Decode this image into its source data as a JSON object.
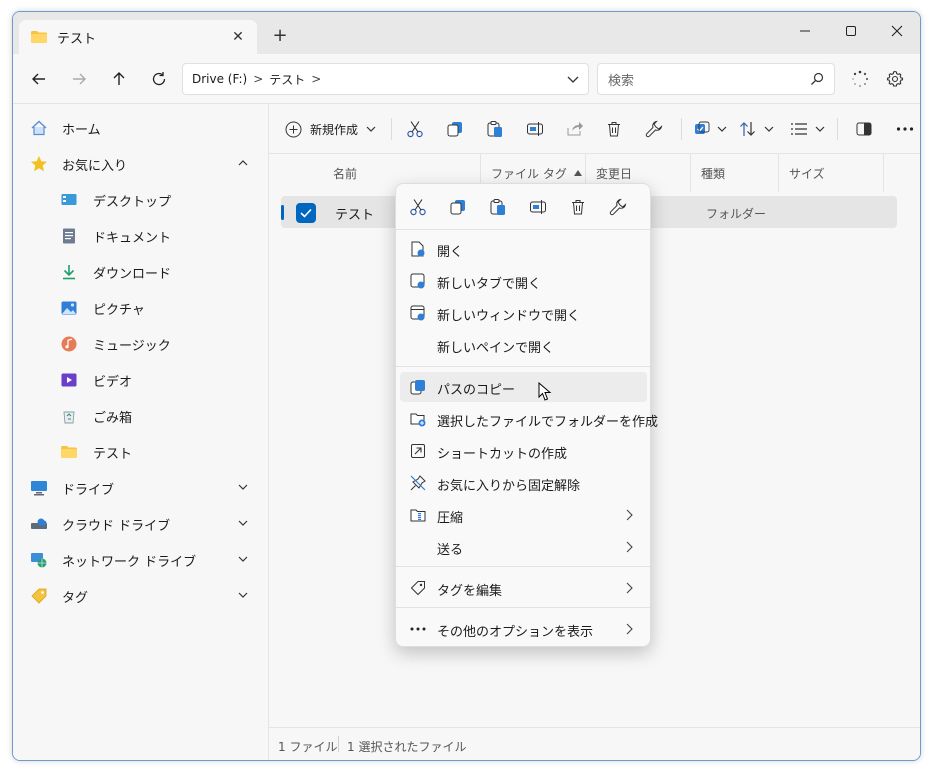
{
  "tab": {
    "title": "テスト",
    "close": "✕",
    "new_tab": "+"
  },
  "window_buttons": {
    "minimize": "—",
    "maximize": "☐",
    "close": "✕"
  },
  "address": {
    "drive": "Drive (F:)",
    "folder": "テスト",
    "separator": ">"
  },
  "search": {
    "placeholder": "検索"
  },
  "sidebar": {
    "items": [
      {
        "label": "ホーム",
        "icon": "home-icon"
      },
      {
        "label": "お気に入り",
        "icon": "star-icon"
      },
      {
        "label": "デスクトップ",
        "icon": "desktop-icon"
      },
      {
        "label": "ドキュメント",
        "icon": "document-icon"
      },
      {
        "label": "ダウンロード",
        "icon": "download-icon"
      },
      {
        "label": "ピクチャ",
        "icon": "picture-icon"
      },
      {
        "label": "ミュージック",
        "icon": "music-icon"
      },
      {
        "label": "ビデオ",
        "icon": "video-icon"
      },
      {
        "label": "ごみ箱",
        "icon": "recycle-bin-icon"
      },
      {
        "label": "テスト",
        "icon": "folder-icon"
      },
      {
        "label": "ドライブ",
        "icon": "drive-icon"
      },
      {
        "label": "クラウド ドライブ",
        "icon": "cloud-drive-icon"
      },
      {
        "label": "ネットワーク ドライブ",
        "icon": "network-drive-icon"
      },
      {
        "label": "タグ",
        "icon": "tag-icon"
      }
    ]
  },
  "toolbar": {
    "new_label": "新規作成"
  },
  "columns": {
    "name": "名前",
    "file_tag": "ファイル タグ",
    "modified": "変更日",
    "type": "種類",
    "size": "サイズ"
  },
  "file_row": {
    "name": "テスト",
    "type": "フォルダー"
  },
  "status": {
    "count": "1 ファイル",
    "selected": "1 選択されたファイル"
  },
  "context_menu": {
    "items": [
      {
        "label": "開く",
        "icon": "open-icon"
      },
      {
        "label": "新しいタブで開く",
        "icon": "open-new-tab-icon"
      },
      {
        "label": "新しいウィンドウで開く",
        "icon": "open-new-window-icon"
      },
      {
        "label": "新しいペインで開く",
        "icon": ""
      },
      {
        "label": "パスのコピー",
        "icon": "copy-path-icon"
      },
      {
        "label": "選択したファイルでフォルダーを作成",
        "icon": "new-folder-icon"
      },
      {
        "label": "ショートカットの作成",
        "icon": "shortcut-icon"
      },
      {
        "label": "お気に入りから固定解除",
        "icon": "unpin-icon"
      },
      {
        "label": "圧縮",
        "icon": "zip-icon"
      },
      {
        "label": "送る",
        "icon": ""
      },
      {
        "label": "タグを編集",
        "icon": "tag-icon"
      },
      {
        "label": "その他のオプションを表示",
        "icon": "more-icon"
      }
    ]
  },
  "colors": {
    "accent": "#0067c0",
    "folder": "#f6c343"
  }
}
